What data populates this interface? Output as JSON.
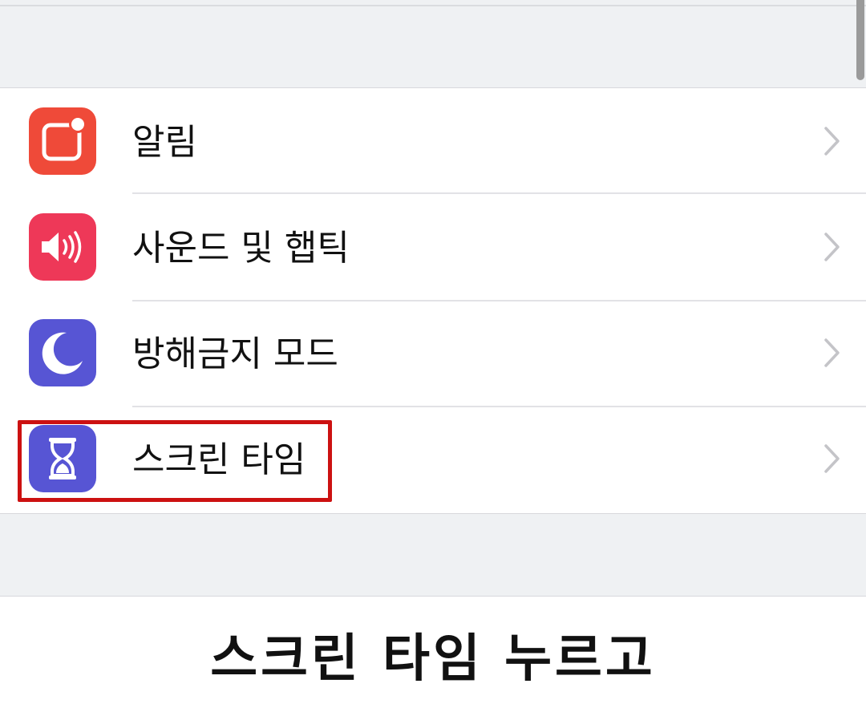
{
  "settings_list": {
    "items": [
      {
        "label": "알림",
        "icon": "notifications-icon",
        "icon_color": "#ef4a39"
      },
      {
        "label": "사운드 및 햅틱",
        "icon": "speaker-icon",
        "icon_color": "#ee3858"
      },
      {
        "label": "방해금지 모드",
        "icon": "moon-icon",
        "icon_color": "#5755d4"
      },
      {
        "label": "스크린 타임",
        "icon": "hourglass-icon",
        "icon_color": "#5755d4"
      }
    ]
  },
  "annotation": {
    "caption": "스크린 타임 누르고",
    "highlight_color": "#cc1111",
    "highlighted_item": "스크린 타임"
  }
}
